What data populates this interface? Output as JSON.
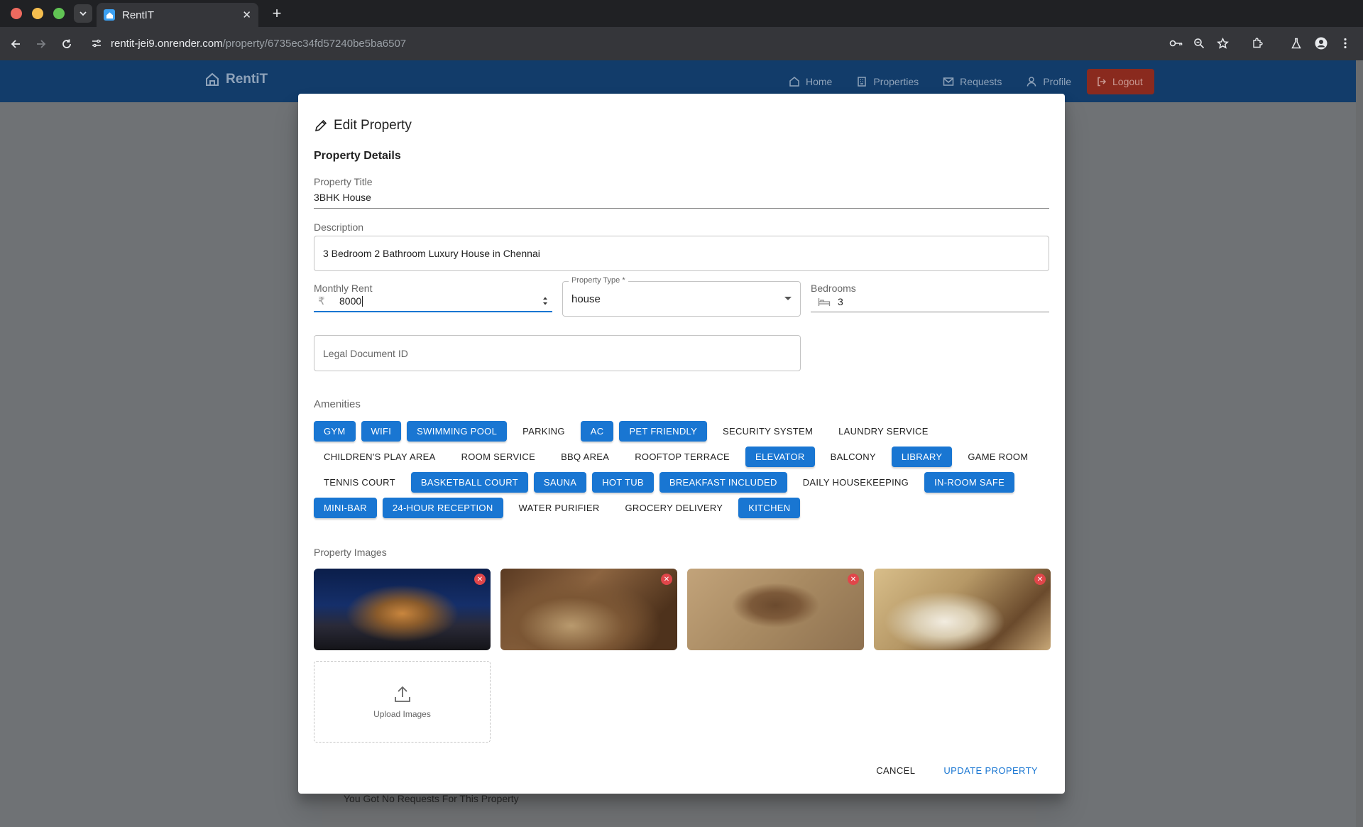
{
  "browser": {
    "tab_title": "RentIT",
    "url_host": "rentit-jei9.onrender.com",
    "url_path": "/property/6735ec34fd57240be5ba6507"
  },
  "app": {
    "brand": "RentiT",
    "nav": [
      {
        "label": "Home",
        "icon": "home-icon"
      },
      {
        "label": "Properties",
        "icon": "building-icon"
      },
      {
        "label": "Requests",
        "icon": "mail-icon"
      },
      {
        "label": "Profile",
        "icon": "user-icon"
      }
    ],
    "logout_label": "Logout",
    "background_text": "You Got No Requests For This Property"
  },
  "dialog": {
    "title": "Edit Property",
    "section_title": "Property Details",
    "title_field": {
      "label": "Property Title",
      "value": "3BHK House"
    },
    "description_field": {
      "label": "Description",
      "value": "3 Bedroom 2 Bathroom Luxury House in Chennai"
    },
    "rent_field": {
      "label": "Monthly Rent",
      "currency": "₹",
      "value": "8000"
    },
    "type_field": {
      "label": "Property Type *",
      "value": "house"
    },
    "bedrooms_field": {
      "label": "Bedrooms",
      "value": "3"
    },
    "legal_field": {
      "placeholder": "Legal Document ID"
    },
    "amenities_label": "Amenities",
    "amenities": [
      {
        "label": "GYM",
        "selected": true
      },
      {
        "label": "WIFI",
        "selected": true
      },
      {
        "label": "SWIMMING POOL",
        "selected": true
      },
      {
        "label": "PARKING",
        "selected": false
      },
      {
        "label": "AC",
        "selected": true
      },
      {
        "label": "PET FRIENDLY",
        "selected": true
      },
      {
        "label": "SECURITY SYSTEM",
        "selected": false
      },
      {
        "label": "LAUNDRY SERVICE",
        "selected": false
      },
      {
        "label": "CHILDREN'S PLAY AREA",
        "selected": false
      },
      {
        "label": "ROOM SERVICE",
        "selected": false
      },
      {
        "label": "BBQ AREA",
        "selected": false
      },
      {
        "label": "ROOFTOP TERRACE",
        "selected": false
      },
      {
        "label": "ELEVATOR",
        "selected": true
      },
      {
        "label": "BALCONY",
        "selected": false
      },
      {
        "label": "LIBRARY",
        "selected": true
      },
      {
        "label": "GAME ROOM",
        "selected": false
      },
      {
        "label": "TENNIS COURT",
        "selected": false
      },
      {
        "label": "BASKETBALL COURT",
        "selected": true
      },
      {
        "label": "SAUNA",
        "selected": true
      },
      {
        "label": "HOT TUB",
        "selected": true
      },
      {
        "label": "BREAKFAST INCLUDED",
        "selected": true
      },
      {
        "label": "DAILY HOUSEKEEPING",
        "selected": false
      },
      {
        "label": "IN-ROOM SAFE",
        "selected": true
      },
      {
        "label": "MINI-BAR",
        "selected": true
      },
      {
        "label": "24-HOUR RECEPTION",
        "selected": true
      },
      {
        "label": "WATER PURIFIER",
        "selected": false
      },
      {
        "label": "GROCERY DELIVERY",
        "selected": false
      },
      {
        "label": "KITCHEN",
        "selected": true
      }
    ],
    "images_label": "Property Images",
    "images": [
      {
        "name": "property-image-exterior-night"
      },
      {
        "name": "property-image-kitchen"
      },
      {
        "name": "property-image-bathroom-mirror"
      },
      {
        "name": "property-image-bedroom"
      }
    ],
    "upload_label": "Upload Images",
    "cancel_label": "CANCEL",
    "update_label": "UPDATE PROPERTY"
  },
  "colors": {
    "primary": "#1976d2",
    "appbar": "#1565c0",
    "logout": "#d32f2f",
    "remove_badge": "#e0464a"
  }
}
